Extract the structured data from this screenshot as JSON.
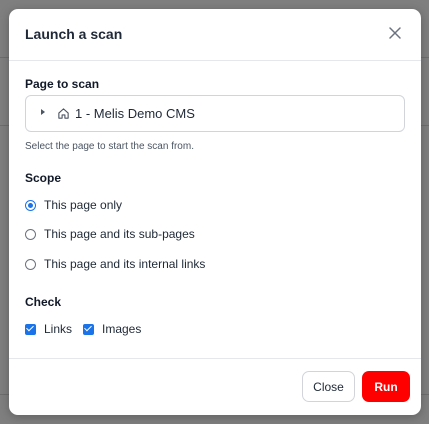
{
  "modal": {
    "title": "Launch a scan",
    "page_section_label": "Page to scan",
    "page_selector": {
      "page_name": "1 - Melis Demo CMS",
      "help_text": "Select the page to start the scan from."
    },
    "scope_label": "Scope",
    "scope_options": [
      {
        "label": "This page only",
        "checked": true
      },
      {
        "label": "This page and its sub-pages",
        "checked": false
      },
      {
        "label": "This page and its internal links",
        "checked": false
      }
    ],
    "check_label": "Check",
    "check_options": [
      {
        "label": "Links",
        "checked": true
      },
      {
        "label": "Images",
        "checked": true
      }
    ],
    "buttons": {
      "close": "Close",
      "run": "Run"
    }
  },
  "colors": {
    "accent": "#1a73e8",
    "run_button": "#ff0000"
  }
}
